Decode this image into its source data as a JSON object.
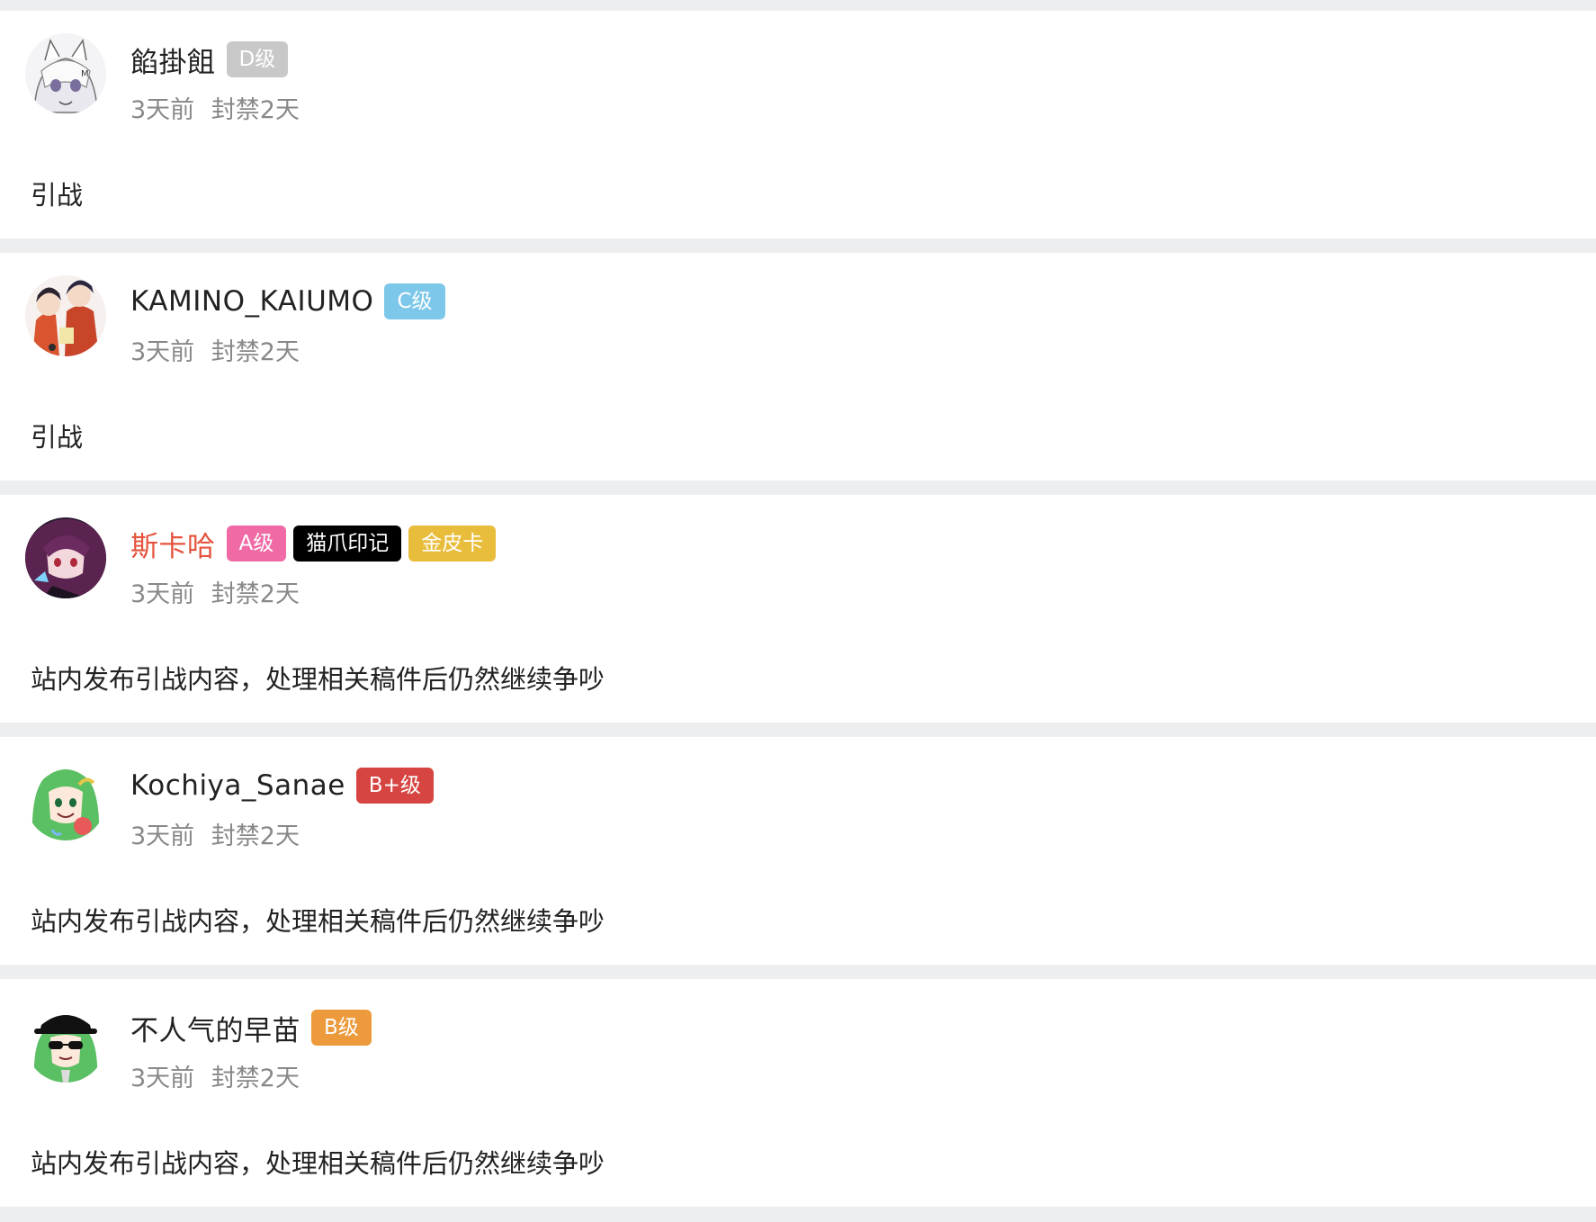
{
  "records": [
    {
      "username": "餡掛飷",
      "username_color": "#222222",
      "avatar": "white-haired-cat-girl-avatar",
      "badges": [
        {
          "label": "D级",
          "color": "#c8c8c8"
        }
      ],
      "time_ago": "3天前",
      "ban_duration": "封禁2天",
      "reason": "引战"
    },
    {
      "username": "KAMINO_KAIUMO",
      "username_color": "#222222",
      "avatar": "red-jacket-girls-avatar",
      "badges": [
        {
          "label": "C级",
          "color": "#7dc8ea"
        }
      ],
      "time_ago": "3天前",
      "ban_duration": "封禁2天",
      "reason": "引战"
    },
    {
      "username": "斯卡哈",
      "username_color": "#e5533d",
      "avatar": "purple-haired-warrior-avatar",
      "badges": [
        {
          "label": "A级",
          "color": "#f06aa6"
        },
        {
          "label": "猫爪印记",
          "color": "#000000"
        },
        {
          "label": "金皮卡",
          "color": "#e9bd3c"
        }
      ],
      "time_ago": "3天前",
      "ban_duration": "封禁2天",
      "reason": "站内发布引战内容，处理相关稿件后仍然继续争吵"
    },
    {
      "username": "Kochiya_Sanae",
      "username_color": "#222222",
      "avatar": "green-haired-sanae-avatar",
      "badges": [
        {
          "label": "B+级",
          "color": "#d64541"
        }
      ],
      "time_ago": "3天前",
      "ban_duration": "封禁2天",
      "reason": "站内发布引战内容，处理相关稿件后仍然继续争吵"
    },
    {
      "username": "不人气的早苗",
      "username_color": "#222222",
      "avatar": "sanae-black-cap-sunglasses-avatar",
      "badges": [
        {
          "label": "B级",
          "color": "#ec9a3c"
        }
      ],
      "time_ago": "3天前",
      "ban_duration": "封禁2天",
      "reason": "站内发布引战内容，处理相关稿件后仍然继续争吵"
    }
  ]
}
